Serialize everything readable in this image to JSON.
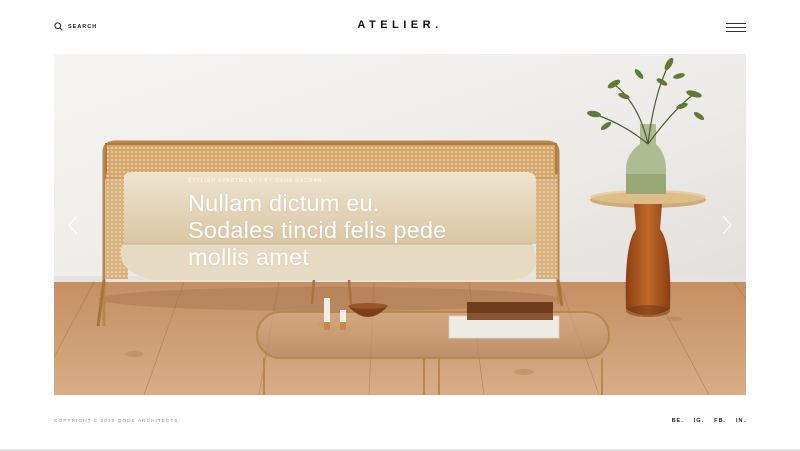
{
  "header": {
    "search_label": "SEARCH",
    "logo": "ATELIER."
  },
  "hero": {
    "eyebrow": "STYLISH APARTMENT | BY DANA RACHAN",
    "title_lines": [
      "Nullam dictum eu.",
      "Sodales tincid felis pede",
      "mollis amet"
    ]
  },
  "footer": {
    "copyright": "COPYRIGHT © 2020 QODE ARCHITECTS.",
    "social": [
      "BE.",
      "IG.",
      "FB.",
      "IN."
    ]
  },
  "icons": {
    "search": "search-icon",
    "menu": "hamburger-menu-icon",
    "prev": "chevron-left-icon",
    "next": "chevron-right-icon"
  },
  "colors": {
    "wall": "#efedea",
    "floor": "#c99a72",
    "brass": "#b8864e",
    "cushion": "#e8dcc6",
    "amber_glass": "#a5541f"
  }
}
